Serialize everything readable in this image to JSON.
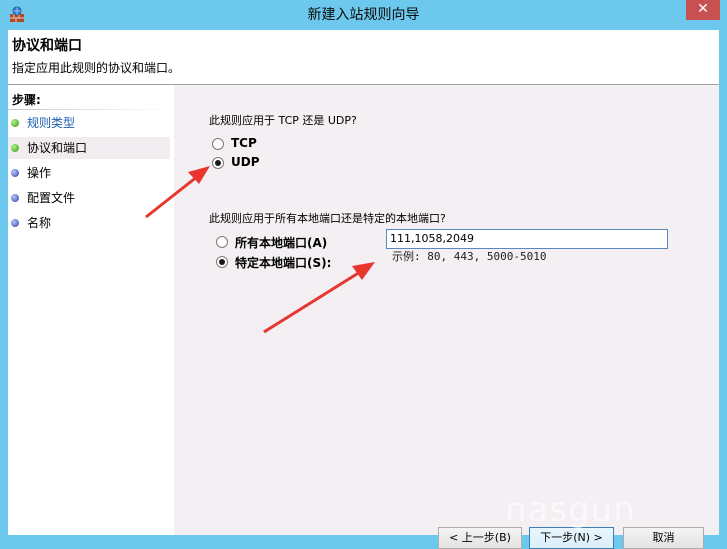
{
  "window": {
    "title": "新建入站规则向导",
    "close_glyph": "✕"
  },
  "header": {
    "title": "协议和端口",
    "subtitle": "指定应用此规则的协议和端口。"
  },
  "sidebar": {
    "title": "步骤:",
    "items": [
      {
        "label": "规则类型",
        "state": "done",
        "dot_color": "green"
      },
      {
        "label": "协议和端口",
        "state": "current",
        "dot_color": "green"
      },
      {
        "label": "操作",
        "state": "pending",
        "dot_color": "blue"
      },
      {
        "label": "配置文件",
        "state": "pending",
        "dot_color": "blue"
      },
      {
        "label": "名称",
        "state": "pending",
        "dot_color": "blue"
      }
    ]
  },
  "protocol": {
    "question": "此规则应用于 TCP 还是 UDP?",
    "options": [
      {
        "label": "TCP",
        "checked": false
      },
      {
        "label": "UDP",
        "checked": true
      }
    ]
  },
  "ports": {
    "question": "此规则应用于所有本地端口还是特定的本地端口?",
    "options": [
      {
        "label": "所有本地端口(A)",
        "checked": false
      },
      {
        "label": "特定本地端口(S):",
        "checked": true
      }
    ],
    "value": "111,1058,2049",
    "example": "示例: 80, 443, 5000-5010"
  },
  "buttons": {
    "back": "< 上一步(B)",
    "next": "下一步(N) >",
    "cancel": "取消"
  },
  "watermark": "nasgun",
  "colors": {
    "titlebar": "#6cc8ec",
    "close": "#c75050",
    "arrow": "#e8362e",
    "content_bg": "#f3eff3"
  }
}
